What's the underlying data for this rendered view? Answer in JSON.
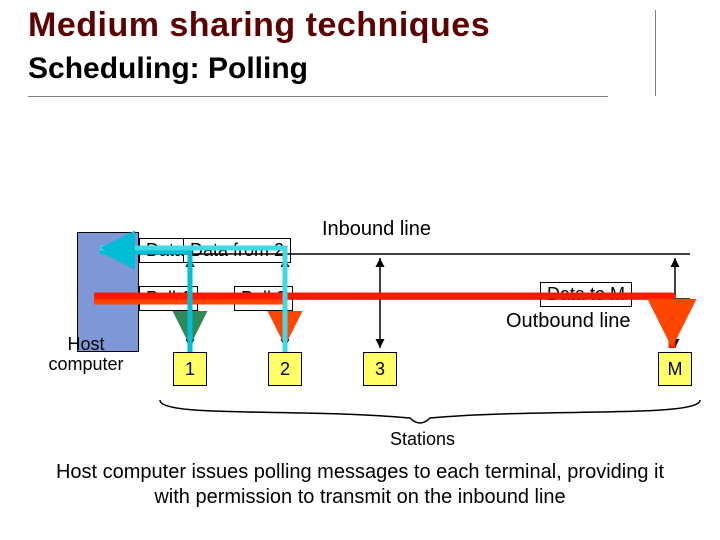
{
  "title": "Medium sharing techniques",
  "subtitle": "Scheduling:  Polling",
  "host_label_1": "Host",
  "host_label_2": "computer",
  "inbound_label": "Inbound line",
  "outbound_label": "Outbound line",
  "stations_label": "Stations",
  "caption": "Host computer issues polling messages to each terminal, providing it with permission to transmit on the inbound line",
  "stations": {
    "s1": "1",
    "s2": "2",
    "s3": "3",
    "sM": "M"
  },
  "messages": {
    "data_from_partial": "Data f",
    "data_from_2": "Data from 2",
    "poll1": "Poll 1",
    "poll2": "Poll 2",
    "data_to_m": "Data to M"
  }
}
